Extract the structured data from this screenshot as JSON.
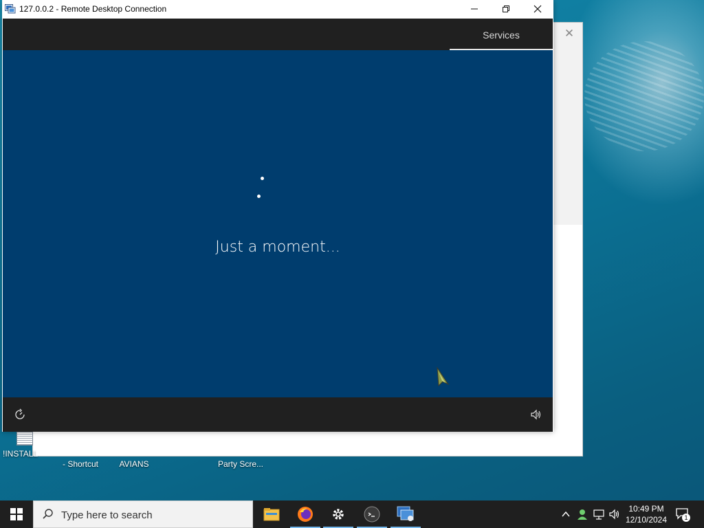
{
  "remote_window": {
    "title": "127.0.0.2 - Remote Desktop Connection",
    "controls": {
      "minimize_icon": "minimize-icon",
      "restore_icon": "restore-icon",
      "close_icon": "close-icon"
    }
  },
  "remote_session": {
    "top_tab": "Services",
    "loading_text": "Just a moment...",
    "bottom_left_icon": "ease-of-access-icon",
    "bottom_right_icon": "volume-icon"
  },
  "background_dialog": {
    "close_icon": "close-icon"
  },
  "desktop_icons": [
    {
      "label": "!INSTALL"
    },
    {
      "label": "- Shortcut"
    },
    {
      "label": "AVIANS"
    },
    {
      "label": "Party Scre..."
    }
  ],
  "taskbar": {
    "search_placeholder": "Type here to search",
    "apps": [
      {
        "name": "file-explorer-icon"
      },
      {
        "name": "firefox-icon"
      },
      {
        "name": "settings-icon"
      },
      {
        "name": "terminal-icon"
      },
      {
        "name": "remote-desktop-icon"
      }
    ],
    "clock": {
      "time": "10:49 PM",
      "date": "12/10/2024"
    },
    "notification_count": "1"
  },
  "colors": {
    "session_blue": "#003d6e",
    "session_bars": "#202020",
    "taskbar": "#1f1f1f"
  }
}
